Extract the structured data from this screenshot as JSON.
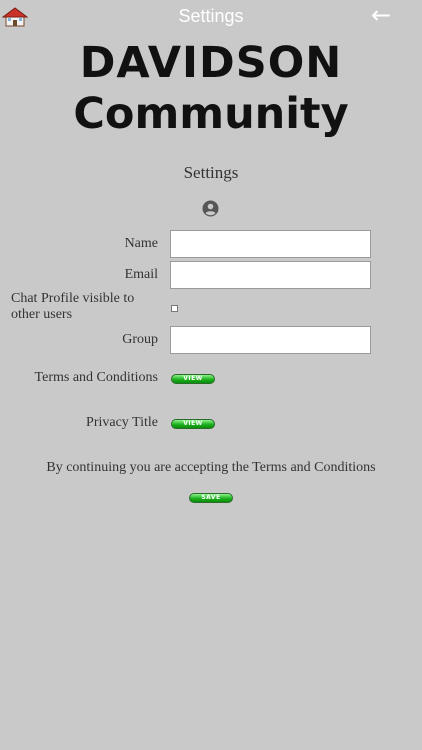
{
  "header": {
    "title": "Settings",
    "home_icon": "house-icon",
    "back_icon": "arrow-left-icon",
    "back_glyph": "←"
  },
  "logo": {
    "line1": "DAVIDSON",
    "line2": "Community"
  },
  "page": {
    "section_title": "Settings",
    "profile_icon": "user-circle-icon"
  },
  "form": {
    "name_label": "Name",
    "name_value": "",
    "email_label": "Email",
    "email_value": "",
    "chat_visible_label": "Chat Profile visible to other users",
    "chat_visible_checked": false,
    "group_label": "Group",
    "group_value": "",
    "terms_label": "Terms and Conditions",
    "terms_button": "VIEW",
    "privacy_label": "Privacy Title",
    "privacy_button": "VIEW",
    "notice": "By continuing you are accepting the Terms and Conditions",
    "save_button": "SAVE"
  },
  "colors": {
    "background": "#c9c9c9",
    "button_green": "#1fb21f",
    "title_white": "#ffffff"
  }
}
